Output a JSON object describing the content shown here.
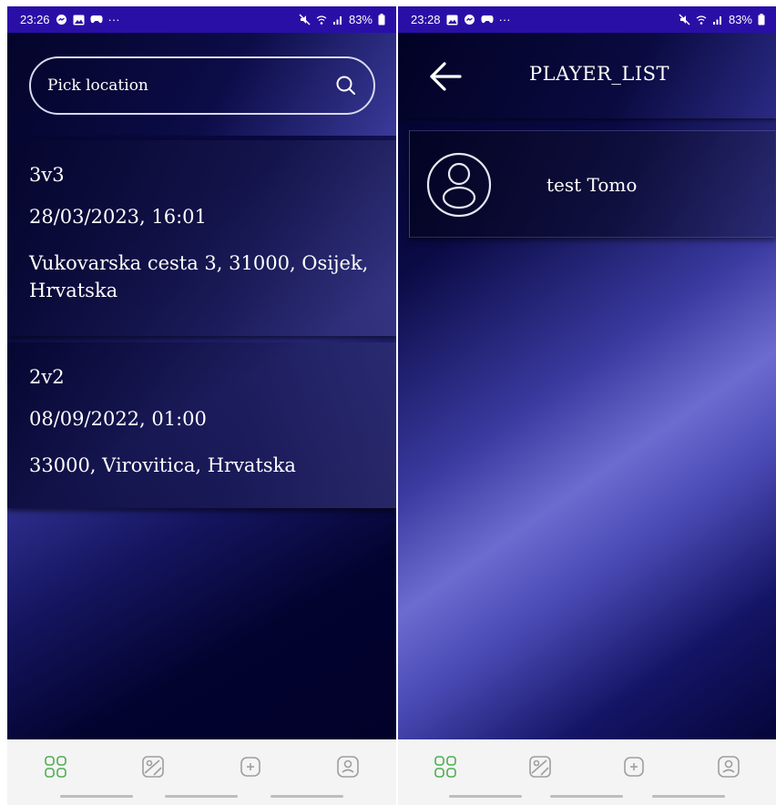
{
  "left_screen": {
    "status_bar": {
      "time": "23:26",
      "dots": "···",
      "battery": "83%"
    },
    "search": {
      "placeholder": "Pick location"
    },
    "games": [
      {
        "type": "3v3",
        "datetime": "28/03/2023, 16:01",
        "address": "Vukovarska cesta 3, 31000, Osijek, Hrvatska"
      },
      {
        "type": "2v2",
        "datetime": "08/09/2022, 01:00",
        "address": "33000, Virovitica, Hrvatska"
      }
    ],
    "bottom_nav": [
      "grid-icon",
      "image-icon",
      "add-icon",
      "profile-icon"
    ]
  },
  "right_screen": {
    "status_bar": {
      "time": "23:28",
      "dots": "···",
      "battery": "83%"
    },
    "header": {
      "title": "PLAYER_LIST"
    },
    "players": [
      {
        "name": "test Tomo"
      }
    ],
    "bottom_nav": [
      "grid-icon",
      "image-icon",
      "add-icon",
      "profile-icon"
    ]
  },
  "colors": {
    "status_bar": "#2a0fa6",
    "nav_active": "#4caf50",
    "nav_inactive": "#9e9e9e",
    "text": "#ffffff"
  }
}
